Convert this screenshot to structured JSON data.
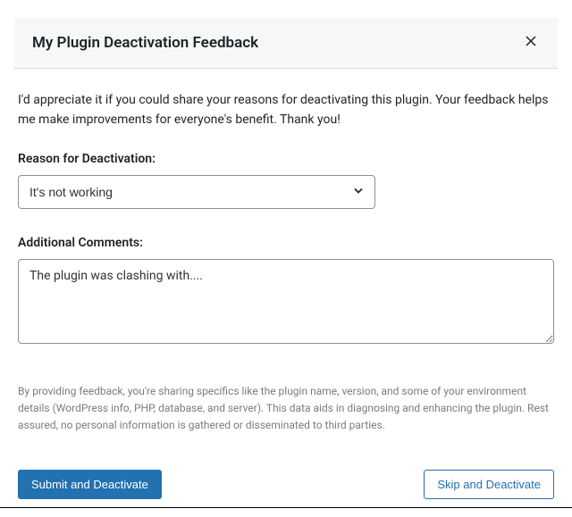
{
  "header": {
    "title": "My Plugin Deactivation Feedback"
  },
  "intro": "I'd appreciate it if you could share your reasons for deactivating this plugin. Your feedback helps me make improvements for everyone's benefit. Thank you!",
  "reason": {
    "label": "Reason for Deactivation:",
    "selected": "It's not working"
  },
  "comments": {
    "label": "Additional Comments:",
    "value": "The plugin was clashing with...."
  },
  "disclaimer": "By providing feedback, you're sharing specifics like the plugin name, version, and some of your environment details (WordPress info, PHP, database, and server). This data aids in diagnosing and enhancing the plugin. Rest assured, no personal information is gathered or disseminated to third parties.",
  "buttons": {
    "submit": "Submit and Deactivate",
    "skip": "Skip and Deactivate"
  }
}
